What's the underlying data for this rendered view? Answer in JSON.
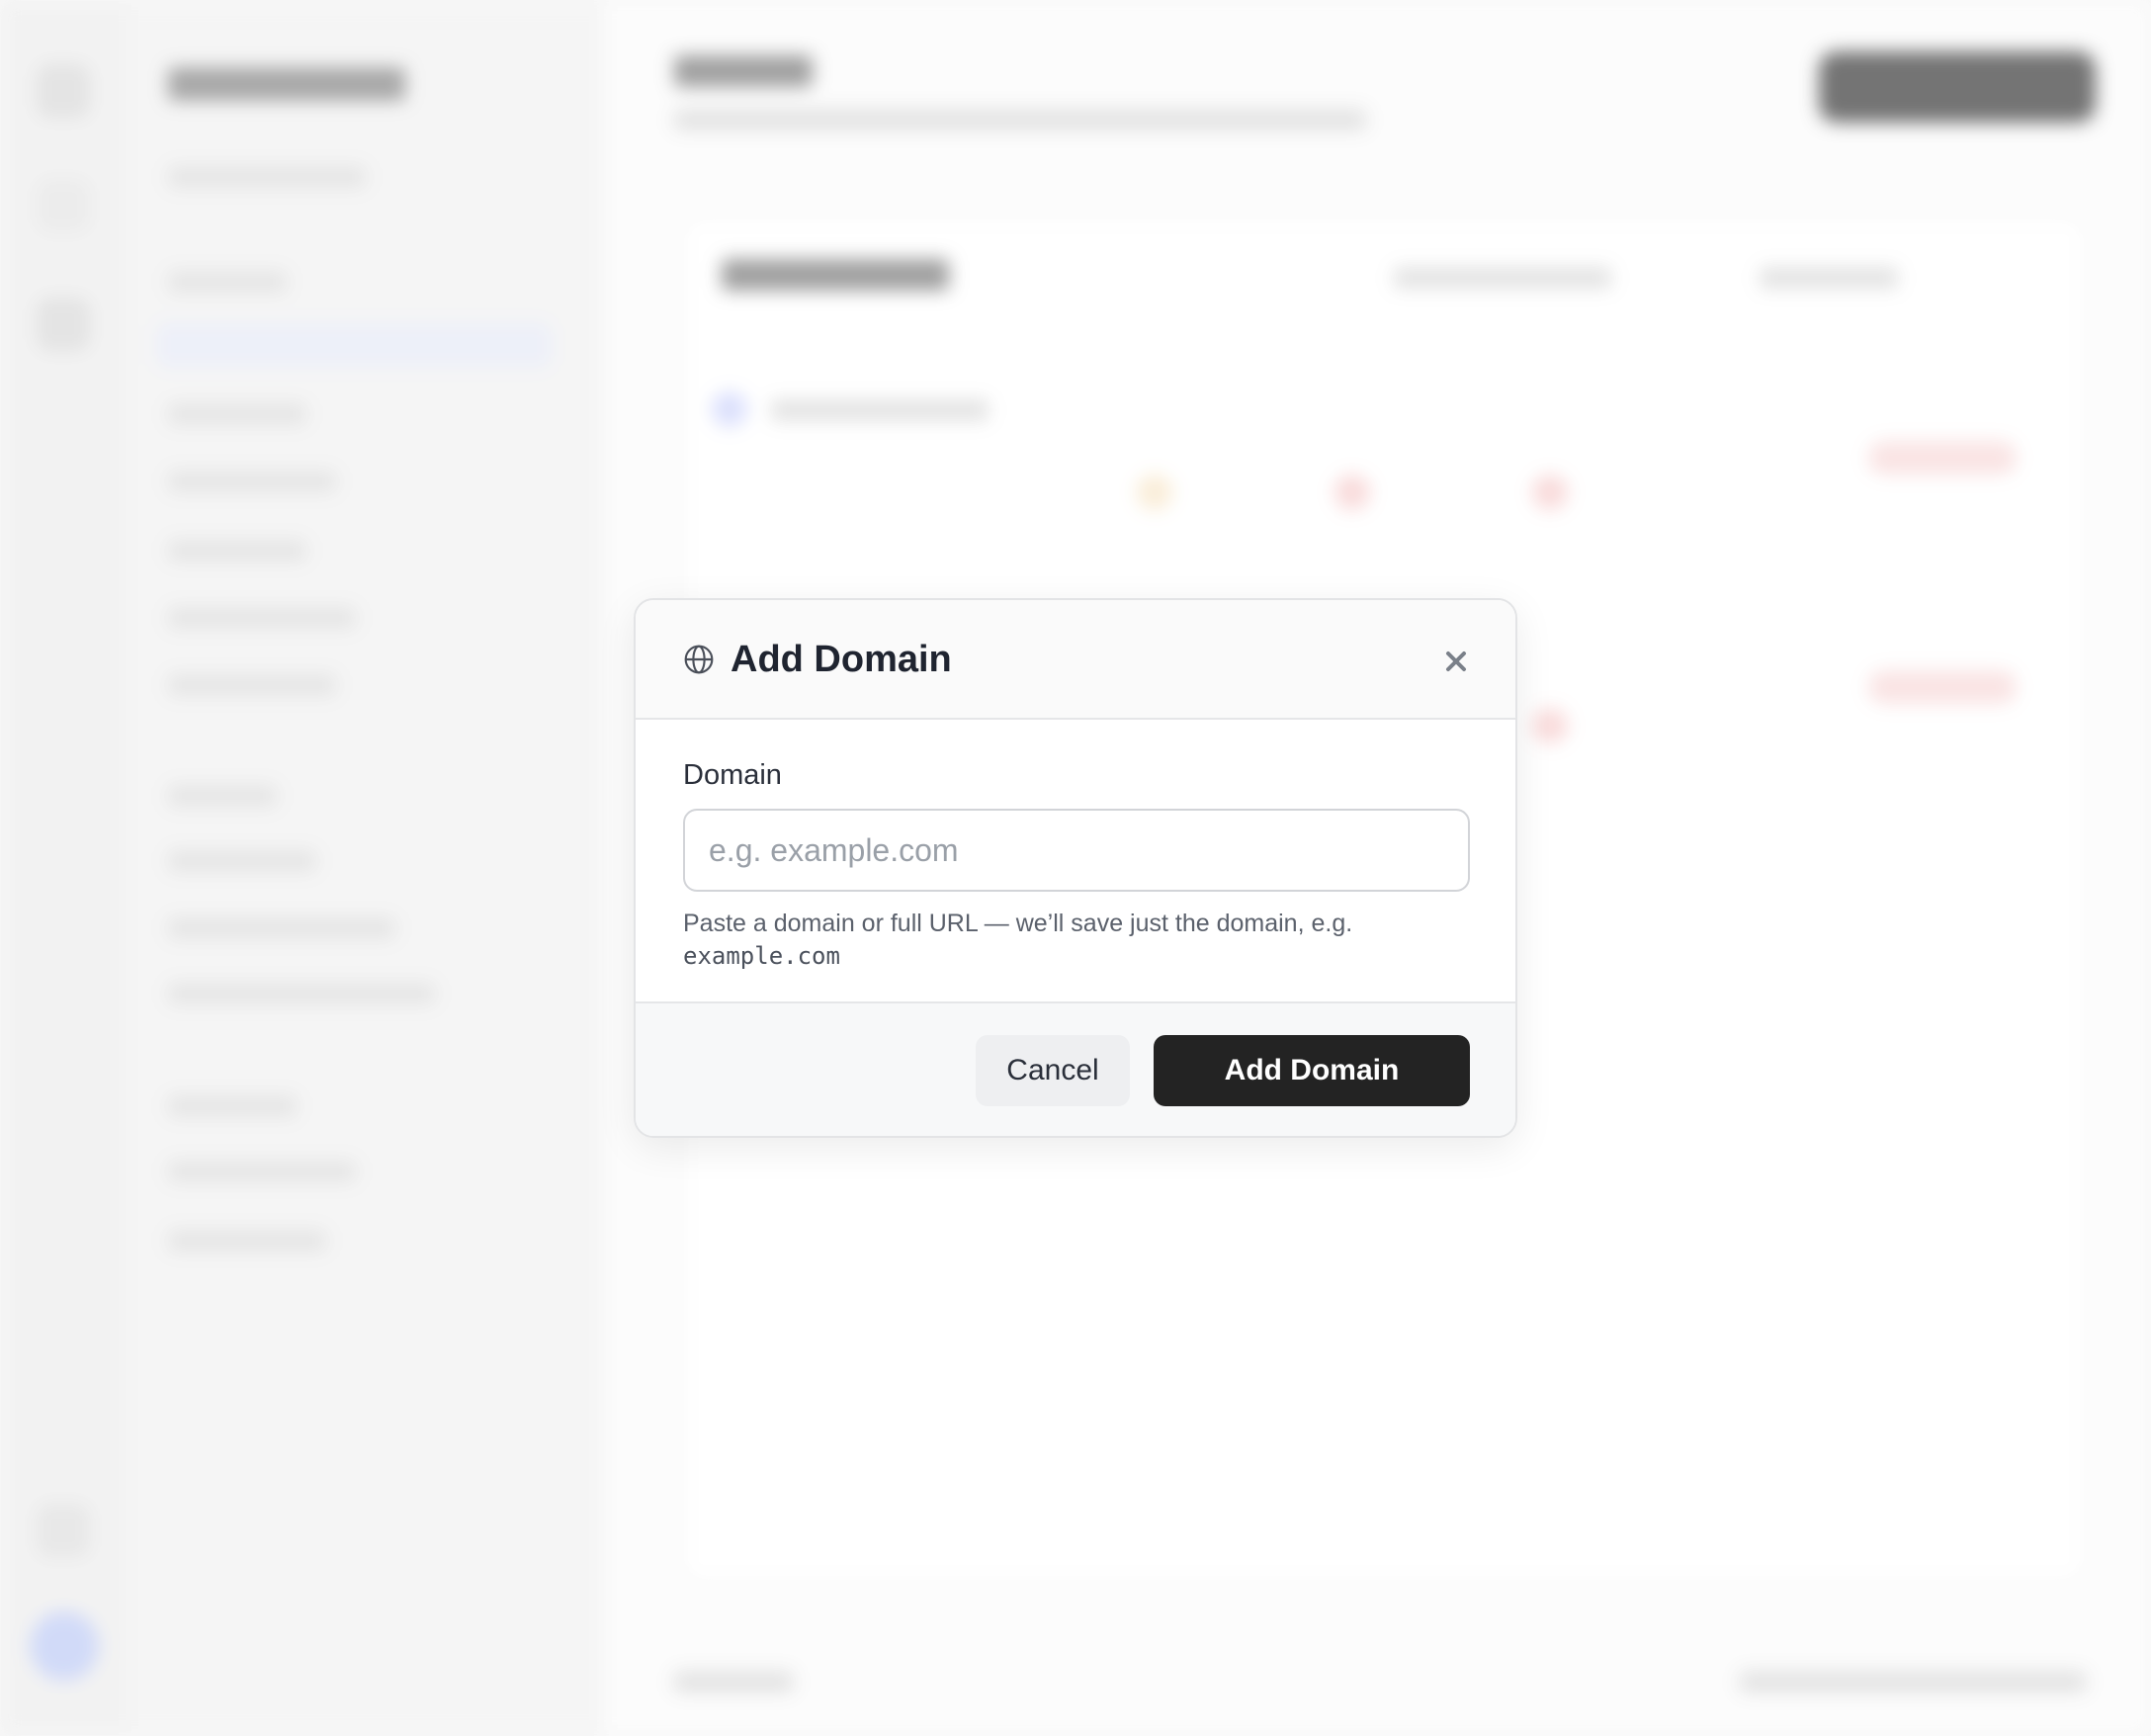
{
  "modal": {
    "title": "Add Domain",
    "icon": "globe-icon",
    "close_icon": "close-icon",
    "field_label": "Domain",
    "input_value": "",
    "input_placeholder": "e.g. example.com",
    "help_text": "Paste a domain or full URL — we’ll save just the domain, e.g.",
    "help_example": "example.com",
    "cancel_label": "Cancel",
    "submit_label": "Add Domain"
  },
  "colors": {
    "primary_button": "#232323",
    "secondary_button": "#eeeff1",
    "title_text": "#1f2430"
  }
}
